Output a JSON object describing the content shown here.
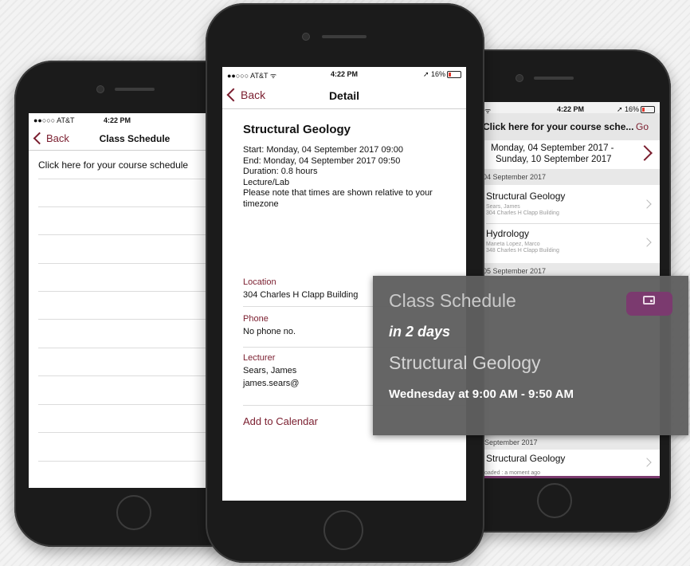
{
  "left_phone": {
    "status": {
      "carrier": "●●○○○ AT&T",
      "time": "4:22 PM"
    },
    "nav": {
      "back": "Back",
      "title": "Class Schedule"
    },
    "rows": [
      "Click here for your course schedule"
    ]
  },
  "center_phone": {
    "status": {
      "carrier": "●●○○○ AT&T",
      "time": "4:22 PM",
      "battery": "16%"
    },
    "nav": {
      "back": "Back",
      "title": "Detail"
    },
    "course_title": "Structural Geology",
    "details": [
      "Start: Monday, 04 September 2017 09:00",
      "End: Monday, 04 September 2017 09:50",
      "Duration: 0.8 hours",
      "Lecture/Lab",
      "Please note that times are shown relative to your timezone"
    ],
    "location_label": "Location",
    "location_value": "304 Charles H Clapp Building",
    "phone_label": "Phone",
    "phone_value": "No phone no.",
    "lecturer_label": "Lecturer",
    "lecturer_name": "Sears, James",
    "lecturer_email": "james.sears@",
    "add_calendar": "Add to Calendar"
  },
  "right_phone": {
    "status": {
      "time": "4:22 PM",
      "battery": "16%"
    },
    "banner": {
      "text": "Click here for your course sche...",
      "go": "Go"
    },
    "date_range": {
      "line1": "Monday, 04 September 2017 -",
      "line2": "Sunday, 10 September 2017"
    },
    "sections": [
      {
        "header": "04 September 2017",
        "items": [
          {
            "title": "Structural Geology",
            "sub1": "Sears, James",
            "sub2": "304 Charles H Clapp Building"
          },
          {
            "title": "Hydrology",
            "sub1": "Maneta Lopez, Marco",
            "sub2": "348 Charles H Clapp Building"
          }
        ]
      },
      {
        "header": "05 September 2017"
      }
    ],
    "bottom_header": "September 2017",
    "bottom_item": "Structural Geology",
    "loaded": "oaded : a moment ago"
  },
  "notification": {
    "app": "Class Schedule",
    "when": "in 2 days",
    "course": "Structural Geology",
    "time": "Wednesday at 9:00 AM - 9:50 AM"
  },
  "colors": {
    "accent": "#7a1d2e",
    "overlay": "#5f5f5f",
    "badge": "#7b3a6f"
  }
}
